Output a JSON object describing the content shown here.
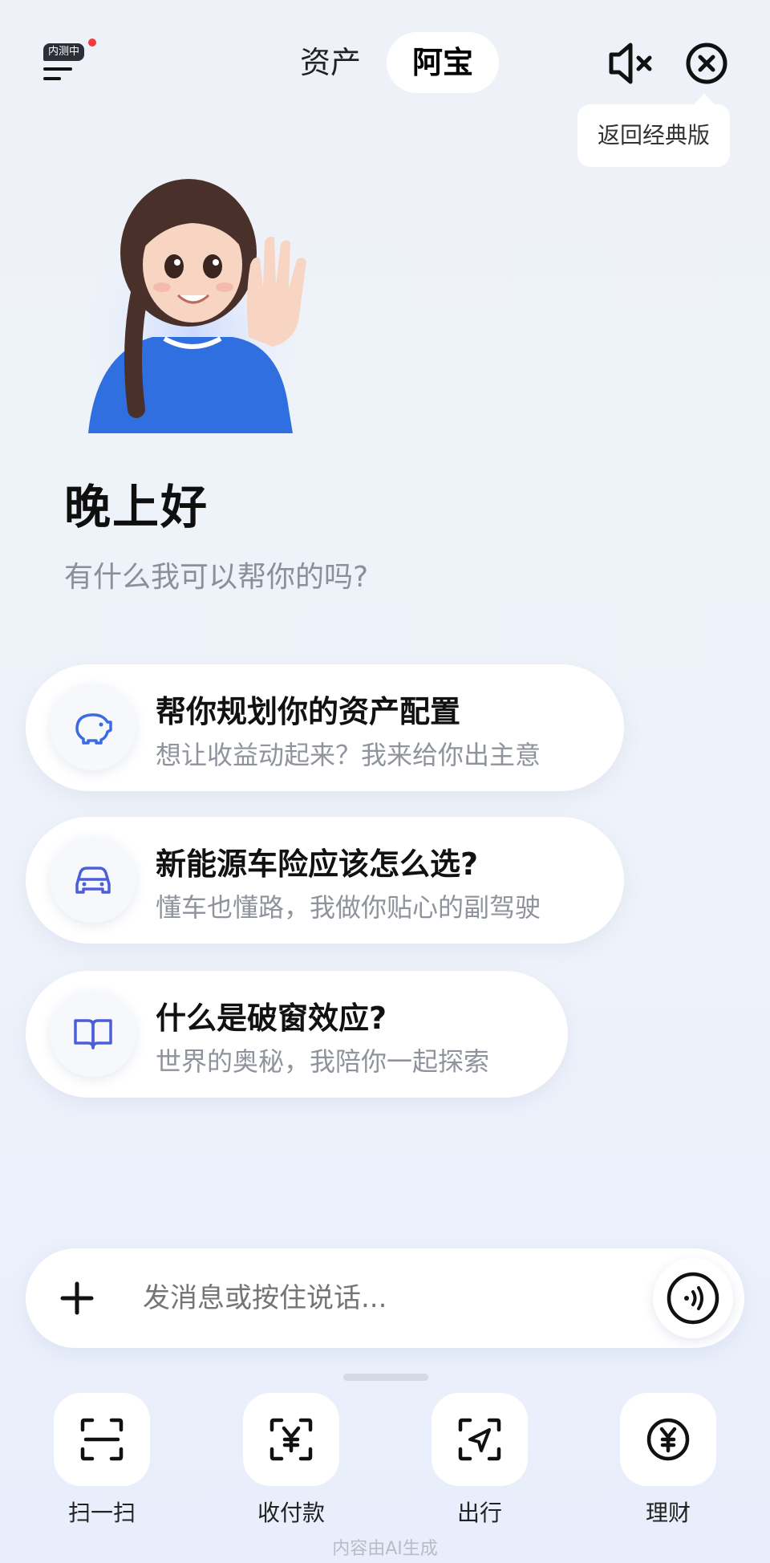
{
  "header": {
    "beta_badge": "内测中",
    "tabs": [
      {
        "label": "资产",
        "active": false
      },
      {
        "label": "阿宝",
        "active": true
      }
    ],
    "tooltip": "返回经典版"
  },
  "greeting": {
    "title": "晚上好",
    "subtitle": "有什么我可以帮你的吗?"
  },
  "suggestions": [
    {
      "icon": "piggy-bank-icon",
      "title": "帮你规划你的资产配置",
      "subtitle": "想让收益动起来？我来给你出主意"
    },
    {
      "icon": "car-icon",
      "title": "新能源车险应该怎么选?",
      "subtitle": "懂车也懂路，我做你贴心的副驾驶"
    },
    {
      "icon": "book-icon",
      "title": "什么是破窗效应?",
      "subtitle": "世界的奥秘，我陪你一起探索"
    }
  ],
  "input": {
    "placeholder": "发消息或按住说话..."
  },
  "dock": [
    {
      "icon": "scan-icon",
      "label": "扫一扫"
    },
    {
      "icon": "payment-icon",
      "label": "收付款"
    },
    {
      "icon": "travel-icon",
      "label": "出行"
    },
    {
      "icon": "wealth-icon",
      "label": "理财"
    }
  ],
  "footer": "内容由AI生成",
  "colors": {
    "accent": "#3b6be0",
    "background": "#eef2f8",
    "badge_dot": "#f23b3b"
  }
}
